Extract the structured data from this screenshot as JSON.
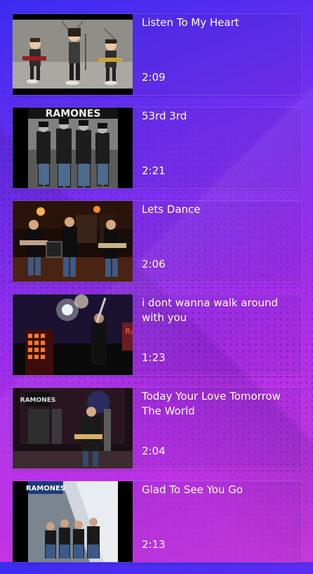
{
  "videos": [
    {
      "title": "Listen To My Heart",
      "duration": "2:09",
      "thumb": "cartoon-band-thumbnail"
    },
    {
      "title": "53rd 3rd",
      "duration": "2:21",
      "thumb": "band-photo-thumbnail"
    },
    {
      "title": "Lets Dance",
      "duration": "2:06",
      "thumb": "live-concert-thumbnail"
    },
    {
      "title": "i dont wanna walk around with you",
      "duration": "1:23",
      "thumb": "stage-lights-thumbnail"
    },
    {
      "title": "Today Your Love Tomorrow The World",
      "duration": "2:04",
      "thumb": "tv-performance-thumbnail"
    },
    {
      "title": "Glad To See You Go",
      "duration": "2:13",
      "thumb": "album-cover-thumbnail"
    }
  ],
  "logo_text": "RAMONES"
}
